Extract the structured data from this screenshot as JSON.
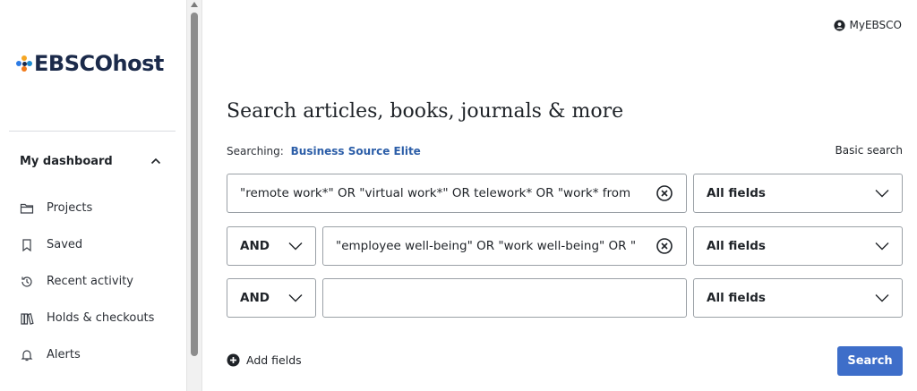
{
  "brand": {
    "logo_text": "EBSCOhost"
  },
  "sidebar": {
    "dashboard_label": "My dashboard",
    "items": [
      {
        "label": "Projects",
        "icon": "folder-icon"
      },
      {
        "label": "Saved",
        "icon": "bookmark-icon"
      },
      {
        "label": "Recent activity",
        "icon": "history-icon"
      },
      {
        "label": "Holds & checkouts",
        "icon": "books-icon"
      },
      {
        "label": "Alerts",
        "icon": "bell-icon"
      }
    ]
  },
  "header": {
    "account_label": "MyEBSCO"
  },
  "main": {
    "title": "Search articles, books, journals & more",
    "searching_label": "Searching:",
    "database": "Business Source Elite",
    "basic_search_link": "Basic search",
    "rows": [
      {
        "operator": null,
        "query": "\"remote work*\" OR \"virtual work*\" OR telework* OR \"work* from",
        "field": "All fields"
      },
      {
        "operator": "AND",
        "query": "\"employee well-being\" OR \"work well-being\" OR \"",
        "field": "All fields"
      },
      {
        "operator": "AND",
        "query": "",
        "field": "All fields"
      }
    ],
    "add_fields_label": "Add fields",
    "search_button": "Search"
  },
  "colors": {
    "accent": "#3e6ec9",
    "link": "#2c5ea8",
    "logo_navy": "#1b2a4a"
  }
}
